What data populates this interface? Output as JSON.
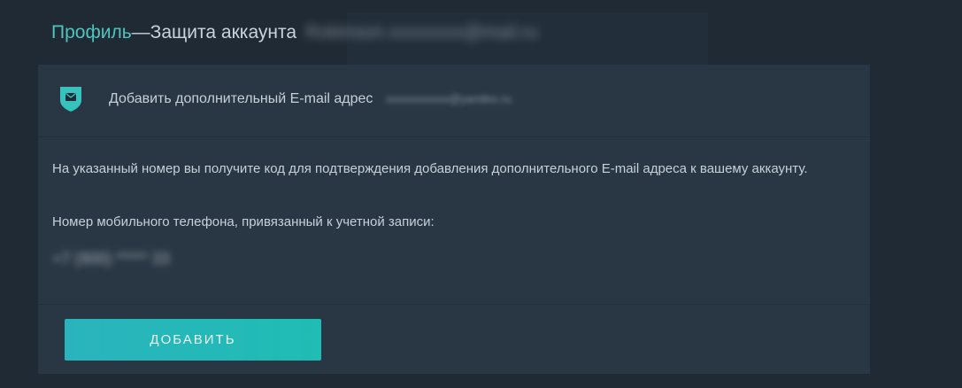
{
  "header": {
    "profile_link": "Профиль",
    "separator": " — ",
    "section_title": "Защита аккаунта",
    "account_email_blurred": "Robinson.xxxxxxxx@mail.ru"
  },
  "card": {
    "icon": "shield-mail-icon",
    "heading": "Добавить дополнительный E-mail адрес",
    "new_email_blurred": "xxxxxxxxxxx@yandex.ru",
    "description": "На указанный номер вы получите код для подтверждения добавления дополнительного E-mail адреса к вашему аккаунту.",
    "phone_label": "Номер мобильного телефона, привязанный к учетной записи:",
    "phone_blurred": "+7 (900) ***** 33",
    "submit_label": "ДОБАВИТЬ"
  },
  "colors": {
    "background": "#1f2a35",
    "card": "#293744",
    "accent": "#4fc4bd",
    "button": "#22b8b8"
  }
}
